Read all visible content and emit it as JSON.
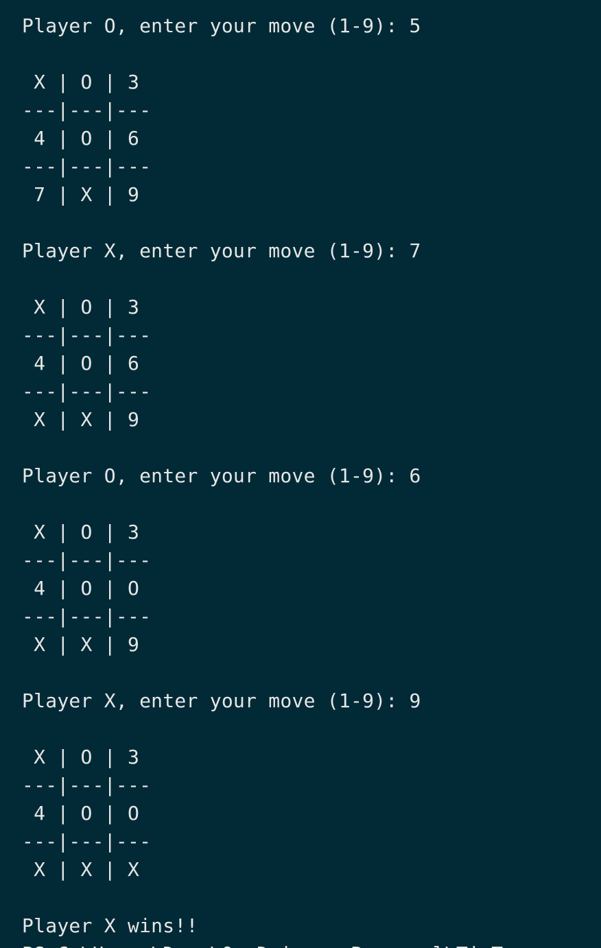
{
  "terminal": {
    "lines": [
      "Player O, enter your move (1-9): 5",
      " X | O | 3",
      "---|---|---",
      " 4 | O | 6",
      "---|---|---",
      " 7 | X | 9",
      "Player X, enter your move (1-9): 7",
      " X | O | 3",
      "---|---|---",
      " 4 | O | 6",
      "---|---|---",
      " X | X | 9",
      "Player O, enter your move (1-9): 6",
      " X | O | 3",
      "---|---|---",
      " 4 | O | O",
      "---|---|---",
      " X | X | 9",
      "Player X, enter your move (1-9): 9",
      " X | O | 3",
      "---|---|---",
      " 4 | O | O",
      "---|---|---",
      " X | X | X",
      "Player X wins!!",
      "PS C:\\Users\\Demo\\OneDrive - Personal\\TicTac"
    ]
  }
}
